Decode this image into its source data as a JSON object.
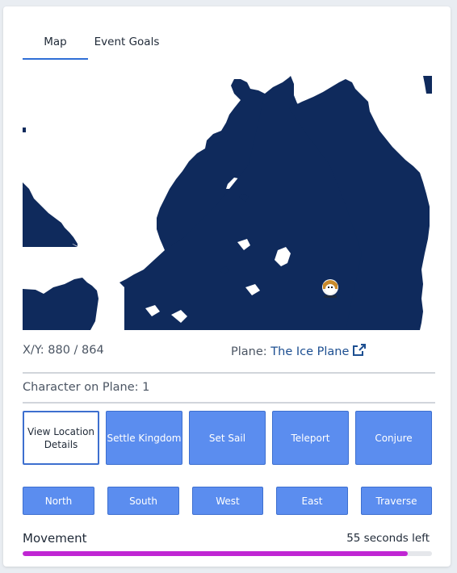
{
  "tabs": [
    {
      "label": "Map",
      "active": true
    },
    {
      "label": "Event Goals",
      "active": false
    }
  ],
  "map": {
    "land_color": "#0f2a5c",
    "water_color": "#ffffff",
    "character_icon": "character-portrait-icon"
  },
  "location": {
    "xy_label": "X/Y:",
    "xy_value": "880 / 864",
    "plane_label": "Plane:",
    "plane_name": "The Ice Plane",
    "plane_link_icon": "external-link-icon"
  },
  "characters": {
    "text": "Character on Plane: 1"
  },
  "actions": [
    {
      "label": "View Location Details",
      "style": "outline"
    },
    {
      "label": "Settle Kingdom",
      "style": "filled"
    },
    {
      "label": "Set Sail",
      "style": "filled"
    },
    {
      "label": "Teleport",
      "style": "filled"
    },
    {
      "label": "Conjure",
      "style": "filled"
    }
  ],
  "directions": [
    "North",
    "South",
    "West",
    "East",
    "Traverse"
  ],
  "movement": {
    "label": "Movement",
    "timer_text": "55 seconds left",
    "progress_fraction": 0.94,
    "bar_color": "#c026d3"
  },
  "colors": {
    "button_bg": "#5b8def",
    "button_border": "#3d6fcf",
    "link": "#1d4f91"
  }
}
